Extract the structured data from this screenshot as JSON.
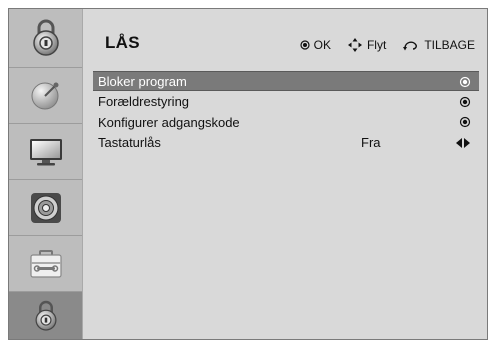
{
  "header": {
    "title": "LÅS",
    "hints": [
      {
        "icon": "ok-icon",
        "label": "OK"
      },
      {
        "icon": "move-arrows-icon",
        "label": "Flyt"
      },
      {
        "icon": "back-icon",
        "label": "TILBAGE"
      }
    ]
  },
  "sidebar": {
    "items": [
      {
        "icon": "satellite-dish-icon",
        "active": false
      },
      {
        "icon": "tv-screen-icon",
        "active": false
      },
      {
        "icon": "speaker-icon",
        "active": false
      },
      {
        "icon": "toolbox-icon",
        "active": false
      },
      {
        "icon": "lock-icon",
        "active": true
      }
    ]
  },
  "menu": {
    "items": [
      {
        "label": "Bloker program",
        "value": "",
        "marker": "radio",
        "selected": true
      },
      {
        "label": "Forældrestyring",
        "value": "",
        "marker": "radio",
        "selected": false
      },
      {
        "label": "Konfigurer adgangskode",
        "value": "",
        "marker": "radio",
        "selected": false
      },
      {
        "label": "Tastaturlås",
        "value": "Fra",
        "marker": "left-right",
        "selected": false
      }
    ]
  },
  "colors": {
    "background": "#d9d9d9",
    "sidebar": "#bdbdbd",
    "active_tab": "#8a8a8a",
    "selected_row": "#7a7a7a"
  }
}
